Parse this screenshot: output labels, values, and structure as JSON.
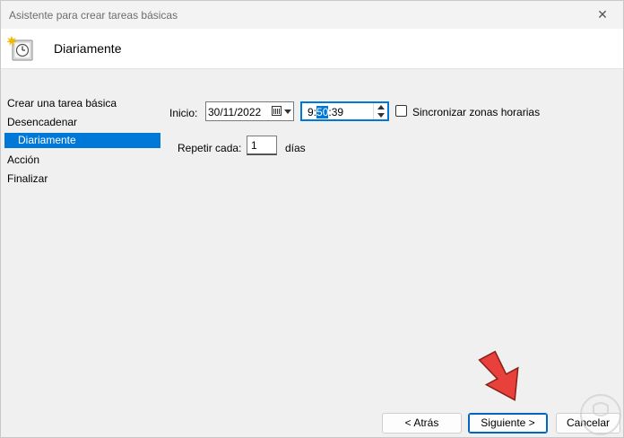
{
  "window": {
    "title": "Asistente para crear tareas básicas",
    "close_glyph": "✕"
  },
  "header": {
    "title": "Diariamente",
    "icon": "task-clock-icon"
  },
  "sidebar": {
    "items": [
      {
        "label": "Crear una tarea básica"
      },
      {
        "label": "Desencadenar"
      },
      {
        "label": "Diariamente",
        "selected": true
      },
      {
        "label": "Acción"
      },
      {
        "label": "Finalizar"
      }
    ]
  },
  "form": {
    "start_label": "Inicio:",
    "start_date": "30/11/2022",
    "start_time_hour": "9:",
    "start_time_minute": "50",
    "start_time_seconds": ":39",
    "sync_label": "Sincronizar zonas horarias",
    "sync_checked": false,
    "repeat_label": "Repetir cada:",
    "repeat_value": "1",
    "repeat_unit": "días"
  },
  "buttons": {
    "back": "< Atrás",
    "next": "Siguiente >",
    "cancel": "Cancelar"
  },
  "colors": {
    "accent": "#0078d7",
    "pointer_arrow": "#e8403a"
  }
}
